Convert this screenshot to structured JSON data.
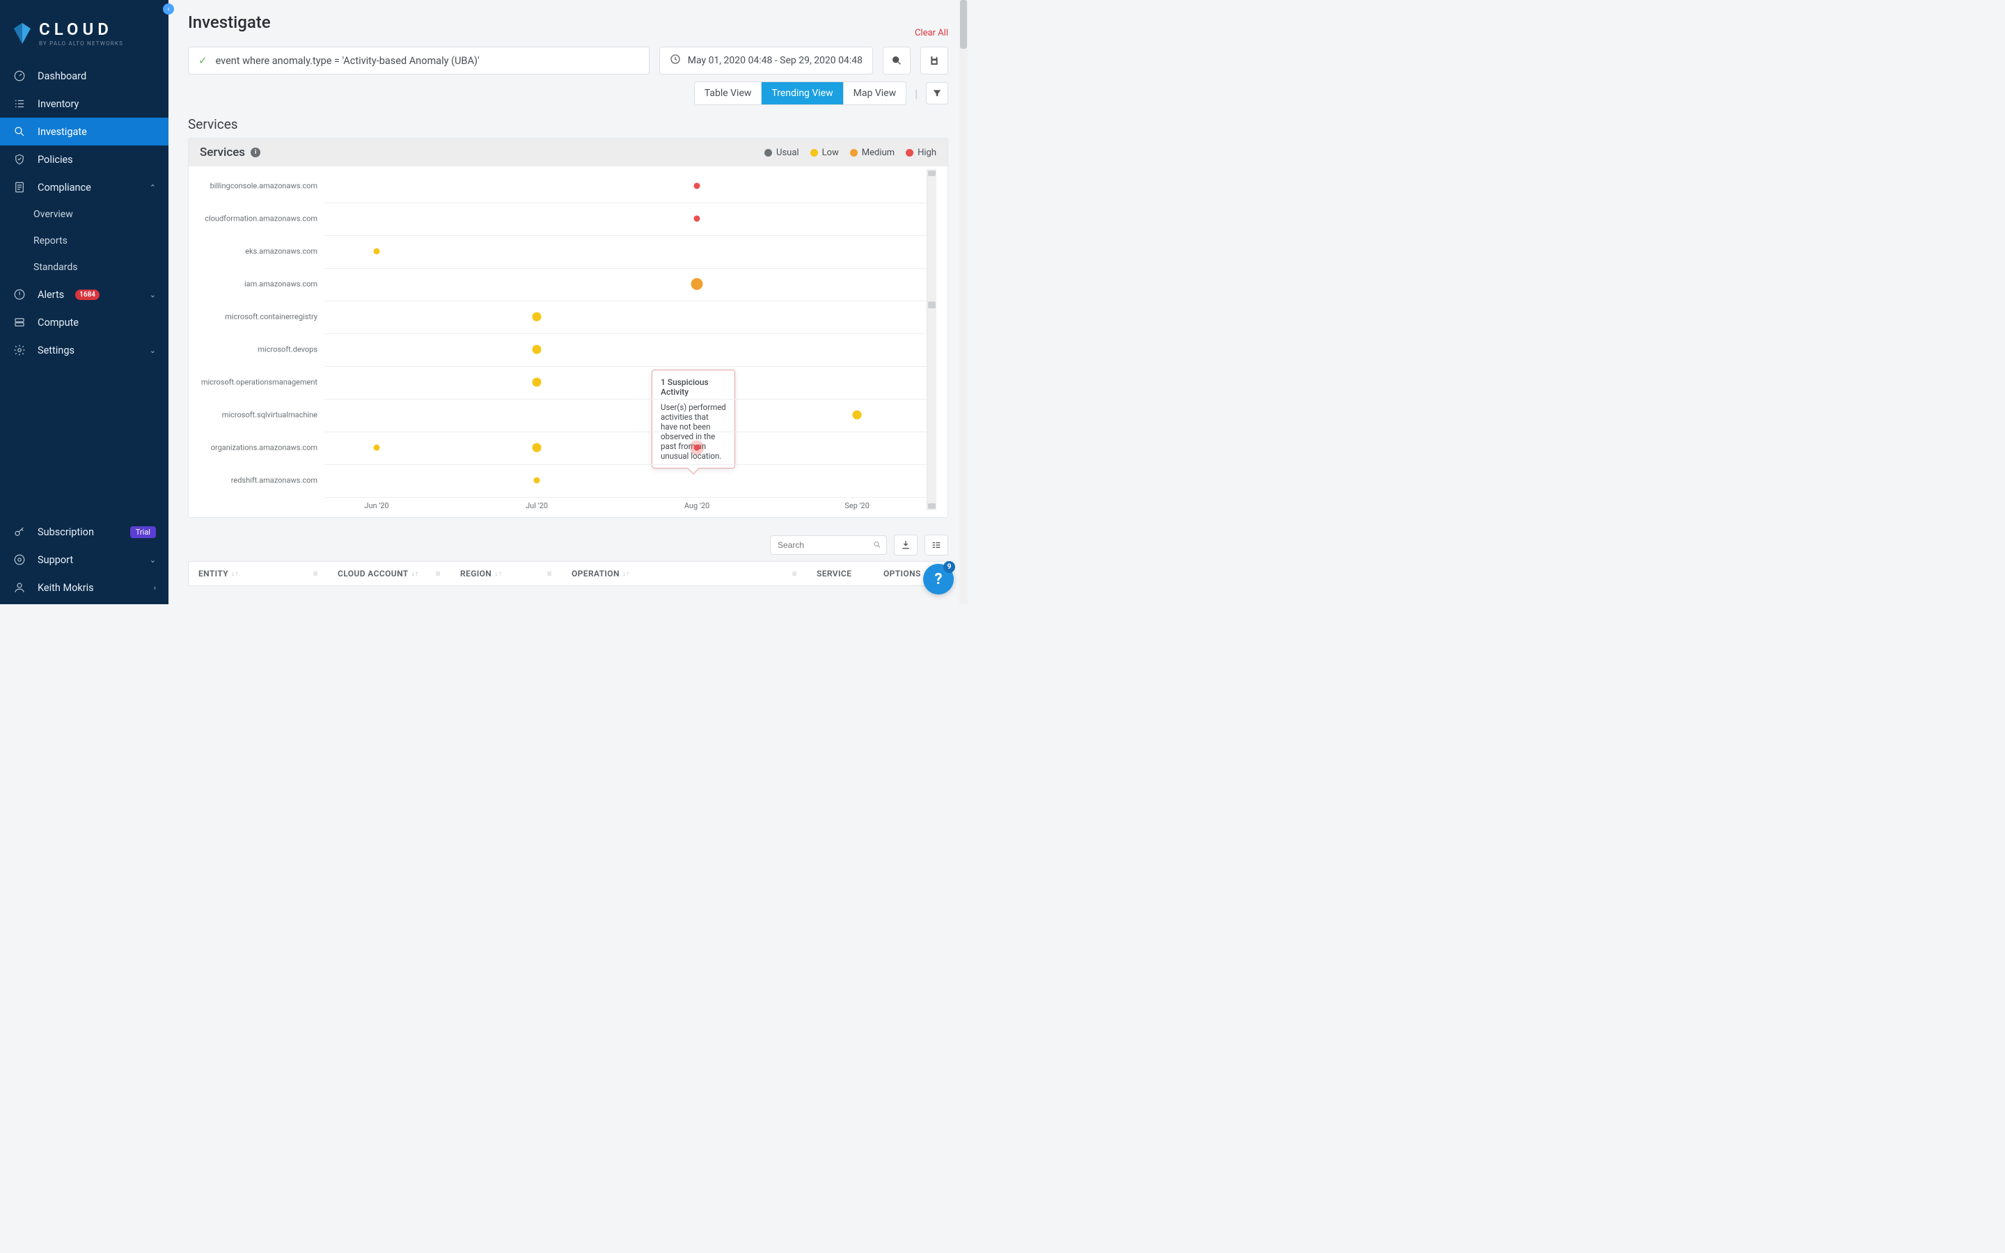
{
  "brand": {
    "word": "CLOUD",
    "sub": "BY PALO ALTO NETWORKS"
  },
  "sidebar": {
    "items": [
      {
        "label": "Dashboard"
      },
      {
        "label": "Inventory"
      },
      {
        "label": "Investigate"
      },
      {
        "label": "Policies"
      },
      {
        "label": "Compliance"
      },
      {
        "label": "Overview"
      },
      {
        "label": "Reports"
      },
      {
        "label": "Standards"
      },
      {
        "label": "Alerts",
        "badge": "1684"
      },
      {
        "label": "Compute"
      },
      {
        "label": "Settings"
      }
    ],
    "bottom": [
      {
        "label": "Subscription",
        "trial": "Trial"
      },
      {
        "label": "Support"
      },
      {
        "label": "Keith Mokris"
      }
    ]
  },
  "page": {
    "title": "Investigate",
    "clear_all": "Clear All",
    "query": "event where anomaly.type = 'Activity-based Anomaly (UBA)'",
    "date_range": "May 01, 2020 04:48 - Sep 29, 2020 04:48",
    "views": [
      "Table View",
      "Trending View",
      "Map View"
    ],
    "active_view": "Trending View"
  },
  "panel": {
    "section_title": "Services",
    "panel_title": "Services",
    "legend": [
      {
        "label": "Usual",
        "color": "#6c7378"
      },
      {
        "label": "Low",
        "color": "#f5c518"
      },
      {
        "label": "Medium",
        "color": "#f0a030"
      },
      {
        "label": "High",
        "color": "#e94f4f"
      }
    ]
  },
  "tooltip": {
    "title": "1 Suspicious Activity",
    "body": "User(s) performed activities that have not been observed in the past from an unusual location."
  },
  "table": {
    "search_placeholder": "Search",
    "columns": [
      "ENTITY",
      "CLOUD ACCOUNT",
      "REGION",
      "OPERATION",
      "SERVICE",
      "OPTIONS"
    ]
  },
  "help_badge": "9",
  "chart_data": {
    "type": "scatter",
    "title": "Services",
    "xlabel": "",
    "ylabel": "",
    "x_categories": [
      "Jun '20",
      "Jul '20",
      "Aug '20",
      "Sep '20"
    ],
    "y_categories": [
      "billingconsole.amazonaws.com",
      "cloudformation.amazonaws.com",
      "eks.amazonaws.com",
      "iam.amazonaws.com",
      "microsoft.containerregistry",
      "microsoft.devops",
      "microsoft.operationsmanagement",
      "microsoft.sqlvirtualmachine",
      "organizations.amazonaws.com",
      "redshift.amazonaws.com"
    ],
    "severity_levels": [
      "Usual",
      "Low",
      "Medium",
      "High"
    ],
    "points": [
      {
        "service": "billingconsole.amazonaws.com",
        "month": "Aug '20",
        "severity": "High",
        "size": "small"
      },
      {
        "service": "cloudformation.amazonaws.com",
        "month": "Aug '20",
        "severity": "High",
        "size": "small"
      },
      {
        "service": "eks.amazonaws.com",
        "month": "Jun '20",
        "severity": "Low",
        "size": "small"
      },
      {
        "service": "iam.amazonaws.com",
        "month": "Aug '20",
        "severity": "Medium",
        "size": "big"
      },
      {
        "service": "microsoft.containerregistry",
        "month": "Jul '20",
        "severity": "Low",
        "size": "med"
      },
      {
        "service": "microsoft.devops",
        "month": "Jul '20",
        "severity": "Low",
        "size": "med"
      },
      {
        "service": "microsoft.operationsmanagement",
        "month": "Jul '20",
        "severity": "Low",
        "size": "med"
      },
      {
        "service": "microsoft.sqlvirtualmachine",
        "month": "Sep '20",
        "severity": "Low",
        "size": "med"
      },
      {
        "service": "organizations.amazonaws.com",
        "month": "Jun '20",
        "severity": "Low",
        "size": "small"
      },
      {
        "service": "organizations.amazonaws.com",
        "month": "Jul '20",
        "severity": "Low",
        "size": "med"
      },
      {
        "service": "organizations.amazonaws.com",
        "month": "Aug '20",
        "severity": "High",
        "size": "small",
        "highlighted": true
      },
      {
        "service": "redshift.amazonaws.com",
        "month": "Jul '20",
        "severity": "Low",
        "size": "small"
      }
    ]
  }
}
